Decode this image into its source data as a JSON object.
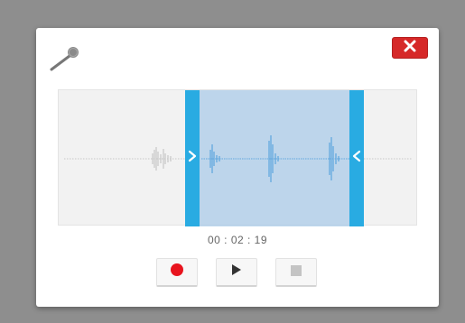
{
  "recorder": {
    "time_display": "00 : 02 : 19"
  },
  "icons": {
    "mic": "microphone-icon",
    "close": "close-x-icon",
    "record": "record-icon",
    "play": "play-icon",
    "stop": "stop-icon",
    "handle_left": "chevron-right-icon",
    "handle_right": "chevron-left-icon"
  },
  "colors": {
    "close_button": "#d62828",
    "selection_fill": "#91bee5",
    "handle": "#29abe2",
    "waveform_active": "#2a8fd6",
    "waveform_inactive": "#c8c8c8",
    "record_dot": "#e8141e"
  },
  "controls": {
    "stop_enabled": false
  }
}
